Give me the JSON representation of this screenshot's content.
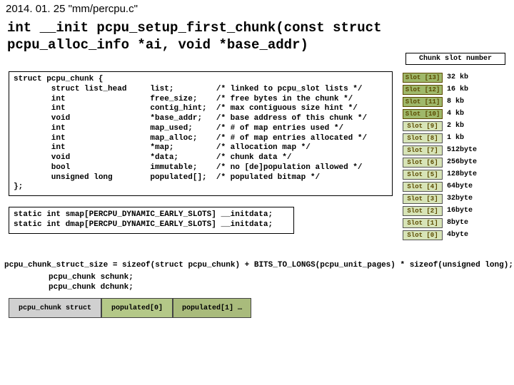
{
  "header": "2014. 01. 25  \"mm/percpu.c\"",
  "signature": "int __init pcpu_setup_first_chunk(const struct pcpu_alloc_info *ai, void *base_addr)",
  "slot_label": "Chunk slot number",
  "struct_code": "struct pcpu_chunk {\n        struct list_head     list;         /* linked to pcpu_slot lists */\n        int                  free_size;    /* free bytes in the chunk */\n        int                  contig_hint;  /* max contiguous size hint */\n        void                 *base_addr;   /* base address of this chunk */\n        int                  map_used;     /* # of map entries used */\n        int                  map_alloc;    /* # of map entries allocated */\n        int                  *map;         /* allocation map */\n        void                 *data;        /* chunk data */\n        bool                 immutable;    /* no [de]population allowed */\n        unsigned long        populated[];  /* populated bitmap */\n};",
  "static_code": "static int smap[PERCPU_DYNAMIC_EARLY_SLOTS] __initdata;\nstatic int dmap[PERCPU_DYNAMIC_EARLY_SLOTS] __initdata;",
  "slots": [
    {
      "name": "Slot [13]",
      "size": "32 kb",
      "emph": true
    },
    {
      "name": "Slot [12]",
      "size": "16 kb",
      "emph": true
    },
    {
      "name": "Slot [11]",
      "size": "8 kb",
      "emph": true
    },
    {
      "name": "Slot [10]",
      "size": "4 kb",
      "emph": true
    },
    {
      "name": "Slot [9]",
      "size": "2 kb",
      "emph": false
    },
    {
      "name": "Slot [8]",
      "size": "1 kb",
      "emph": false
    },
    {
      "name": "Slot [7]",
      "size": "512byte",
      "emph": false
    },
    {
      "name": "Slot [6]",
      "size": "256byte",
      "emph": false
    },
    {
      "name": "Slot [5]",
      "size": "128byte",
      "emph": false
    },
    {
      "name": "Slot [4]",
      "size": "64byte",
      "emph": false
    },
    {
      "name": "Slot [3]",
      "size": "32byte",
      "emph": false
    },
    {
      "name": "Slot [2]",
      "size": "16byte",
      "emph": false
    },
    {
      "name": "Slot [1]",
      "size": "8byte",
      "emph": false
    },
    {
      "name": "Slot [0]",
      "size": "4byte",
      "emph": false
    }
  ],
  "bottom_eq": "pcpu_chunk_struct_size = sizeof(struct pcpu_chunk) + BITS_TO_LONGS(pcpu_unit_pages) * sizeof(unsigned long);",
  "bottom_decls": "pcpu_chunk schunk;\npcpu_chunk dchunk;",
  "diagram": {
    "cell0": "pcpu_chunk struct",
    "cell1": "populated[0]",
    "cell2": "populated[1] …"
  }
}
